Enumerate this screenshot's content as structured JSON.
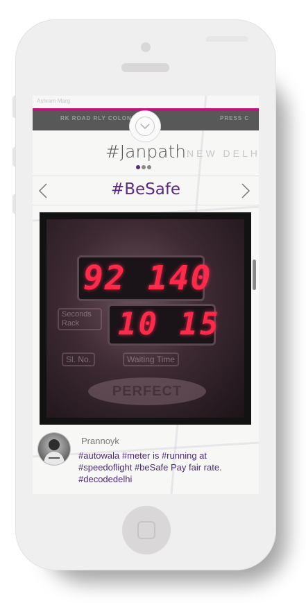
{
  "app": {
    "title": "#Janpath",
    "hashtag": "#BeSafe",
    "page_dots": {
      "count": 3,
      "active_index": 0
    }
  },
  "map_labels": {
    "top_left": "Ashram Marg",
    "banner_left": "RK ROAD RLY COLONY",
    "banner_right": "PRESS C",
    "new_delhi": "NEW DELHI"
  },
  "photo": {
    "display_top": "92 140",
    "display_bottom": "10 15",
    "label_left": "Seconds Rack",
    "label_serial": "Sl. No.",
    "label_waiting": "Waiting Time",
    "brand": "PERFECT"
  },
  "post": {
    "author": "Prannoyk",
    "caption": "#autowala #meter is #running at #speedoflight #beSafe Pay fair rate. #decodedelhi"
  },
  "colors": {
    "accent": "#c2127e",
    "purple": "#5a2a82",
    "banner": "#585858",
    "phone_body": "#efefef"
  },
  "icons": {
    "collapse": "chevron-down-icon",
    "prev": "chevron-left-icon",
    "next": "chevron-right-icon",
    "home": "home-button-icon"
  }
}
